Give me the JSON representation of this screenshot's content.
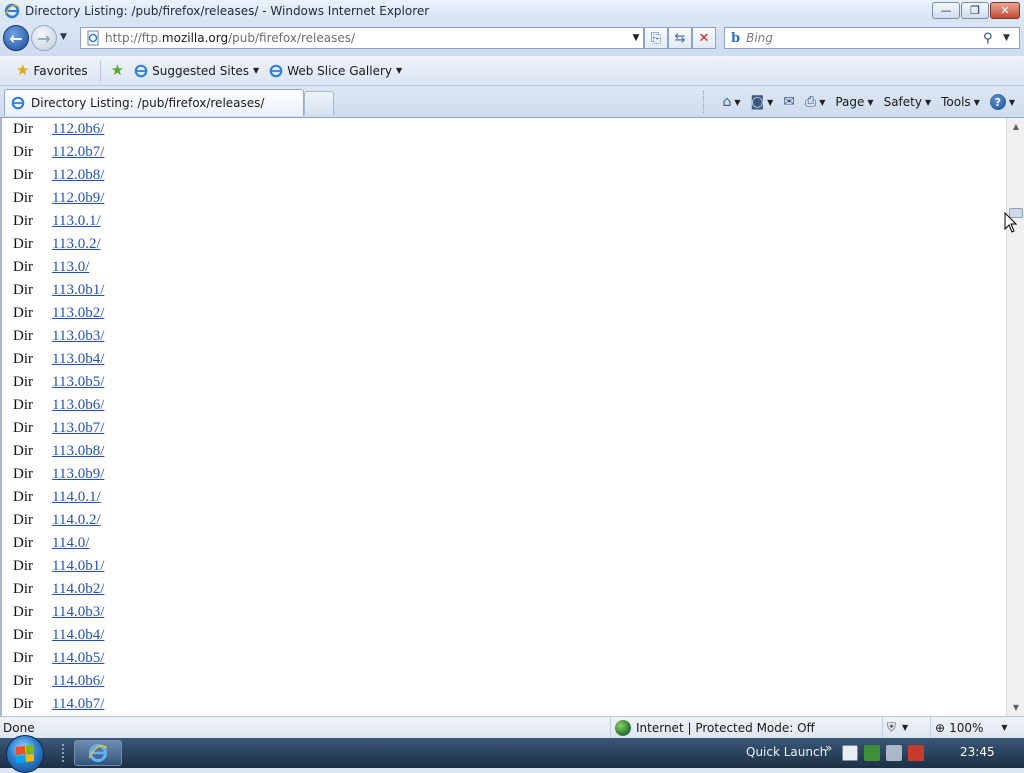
{
  "window": {
    "title": "Directory Listing: /pub/firefox/releases/ - Windows Internet Explorer"
  },
  "address": {
    "url_prefix": "http://ftp.",
    "url_domain": "mozilla.org",
    "url_path": "/pub/firefox/releases/"
  },
  "search": {
    "placeholder": "Bing"
  },
  "favorites_bar": {
    "favorites_label": "Favorites",
    "suggested_sites_label": "Suggested Sites",
    "web_slice_label": "Web Slice Gallery"
  },
  "tab": {
    "title": "Directory Listing: /pub/firefox/releases/"
  },
  "command_bar": {
    "page_label": "Page",
    "safety_label": "Safety",
    "tools_label": "Tools"
  },
  "listing": [
    {
      "type": "Dir",
      "name": "112.0b6/"
    },
    {
      "type": "Dir",
      "name": "112.0b7/"
    },
    {
      "type": "Dir",
      "name": "112.0b8/"
    },
    {
      "type": "Dir",
      "name": "112.0b9/"
    },
    {
      "type": "Dir",
      "name": "113.0.1/"
    },
    {
      "type": "Dir",
      "name": "113.0.2/"
    },
    {
      "type": "Dir",
      "name": "113.0/"
    },
    {
      "type": "Dir",
      "name": "113.0b1/"
    },
    {
      "type": "Dir",
      "name": "113.0b2/"
    },
    {
      "type": "Dir",
      "name": "113.0b3/"
    },
    {
      "type": "Dir",
      "name": "113.0b4/"
    },
    {
      "type": "Dir",
      "name": "113.0b5/"
    },
    {
      "type": "Dir",
      "name": "113.0b6/"
    },
    {
      "type": "Dir",
      "name": "113.0b7/"
    },
    {
      "type": "Dir",
      "name": "113.0b8/"
    },
    {
      "type": "Dir",
      "name": "113.0b9/"
    },
    {
      "type": "Dir",
      "name": "114.0.1/"
    },
    {
      "type": "Dir",
      "name": "114.0.2/"
    },
    {
      "type": "Dir",
      "name": "114.0/"
    },
    {
      "type": "Dir",
      "name": "114.0b1/"
    },
    {
      "type": "Dir",
      "name": "114.0b2/"
    },
    {
      "type": "Dir",
      "name": "114.0b3/"
    },
    {
      "type": "Dir",
      "name": "114.0b4/"
    },
    {
      "type": "Dir",
      "name": "114.0b5/"
    },
    {
      "type": "Dir",
      "name": "114.0b6/"
    },
    {
      "type": "Dir",
      "name": "114.0b7/"
    }
  ],
  "status_bar": {
    "status_text": "Done",
    "zone_text": "Internet | Protected Mode: Off",
    "zoom_text": "100%"
  },
  "taskbar": {
    "quick_launch_label": "Quick Launch",
    "chevron": "»",
    "clock": "23:45"
  },
  "colors": {
    "link": "#2452b8",
    "accent": "#1c4e9a"
  }
}
